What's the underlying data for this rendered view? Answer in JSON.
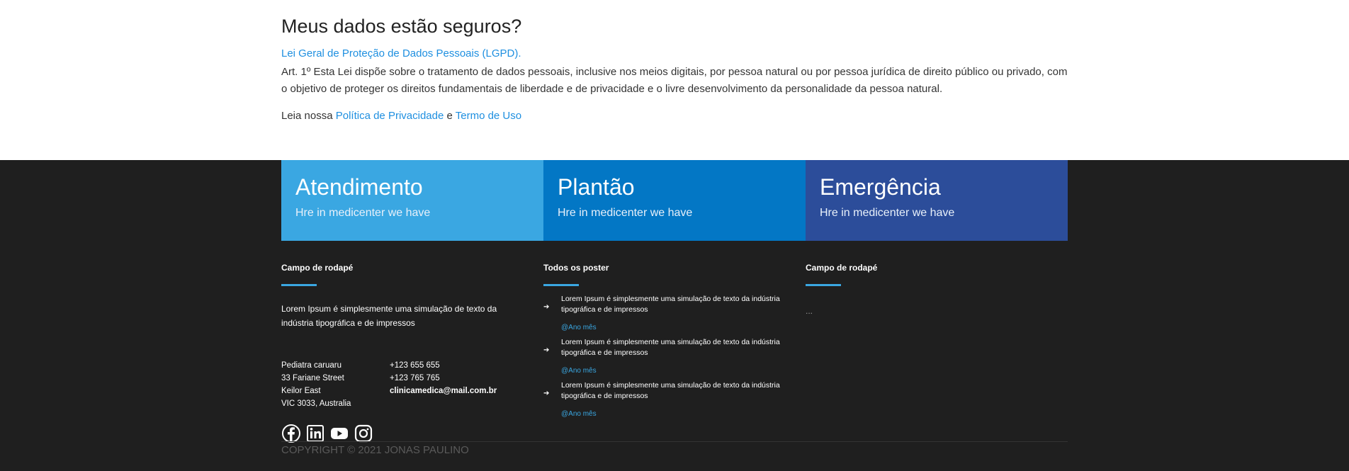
{
  "privacy": {
    "title": "Meus dados estão seguros?",
    "lgpd_link": "Lei Geral de Proteção de Dados Pessoais (LGPD).",
    "article": "Art. 1º Esta Lei dispõe sobre o tratamento de dados pessoais, inclusive nos meios digitais, por pessoa natural ou por pessoa jurídica de direito público ou privado, com o objetivo de proteger os direitos fundamentais de liberdade e de privacidade e o livre desenvolvimento da personalidade da pessoa natural.",
    "read_prefix": "Leia nossa ",
    "privacy_policy": "Política de Privacidade",
    "conjunction": " e ",
    "terms": "Termo de Uso"
  },
  "cards": [
    {
      "title": "Atendimento",
      "subtitle": "Hre in medicenter we have",
      "color": "#3aa7e2"
    },
    {
      "title": "Plantão",
      "subtitle": "Hre in medicenter we have",
      "color": "#0377c5"
    },
    {
      "title": "Emergência",
      "subtitle": "Hre in medicenter we have",
      "color": "#2c4d9a"
    }
  ],
  "footer": {
    "col1": {
      "heading": "Campo de rodapé",
      "description": "Lorem Ipsum é simplesmente uma simulação de texto da indústria tipográfica e de impressos",
      "address": [
        "Pediatra caruaru",
        "33 Fariane Street",
        "Keilor East",
        "VIC 3033, Australia"
      ],
      "phone1": "+123 655 655",
      "phone2": "+123 765 765",
      "email": "clinicamedica@mail.com.br",
      "social": [
        "facebook-icon",
        "linkedin-icon",
        "youtube-icon",
        "instagram-icon"
      ]
    },
    "col2": {
      "heading": "Todos os poster",
      "posts": [
        {
          "text": "Lorem Ipsum é simplesmente uma simulação de texto da indústria tipográfica e de impressos",
          "date": "@Ano mês"
        },
        {
          "text": "Lorem Ipsum é simplesmente uma simulação de texto da indústria tipográfica e de impressos",
          "date": "@Ano mês"
        },
        {
          "text": "Lorem Ipsum é simplesmente uma simulação de texto da indústria tipográfica e de impressos",
          "date": "@Ano mês"
        }
      ]
    },
    "col3": {
      "heading": "Campo de rodapé",
      "content": "..."
    },
    "copyright": "COPYRIGHT © 2021 JONAS PAULINO"
  },
  "colors": {
    "accent": "#3aa7e2",
    "footer_bg": "#1f1f1f",
    "link": "#1e8fe0"
  }
}
